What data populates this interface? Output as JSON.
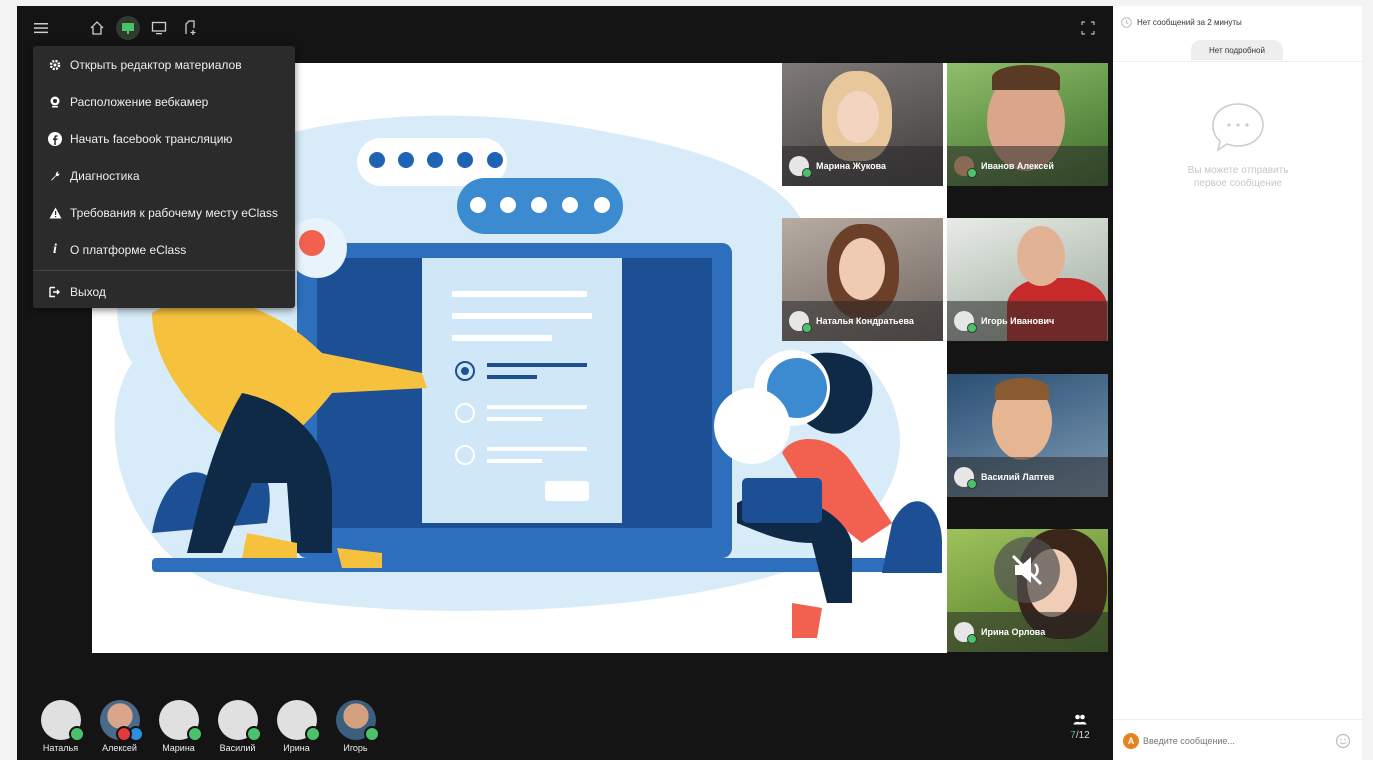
{
  "colors": {
    "accent": "#49c26b",
    "dark": "#141414",
    "menu": "#2b2b2b",
    "chat_avatar": "#e8821e"
  },
  "menu": {
    "items": [
      {
        "label": "Открыть редактор материалов",
        "icon": "gear-icon"
      },
      {
        "label": "Расположение вебкамер",
        "icon": "webcam-icon"
      },
      {
        "label": "Начать facebook трансляцию",
        "icon": "facebook-icon"
      },
      {
        "label": "Диагностика",
        "icon": "wrench-icon"
      },
      {
        "label": "Требования к рабочему месту eClass",
        "icon": "warning-icon"
      },
      {
        "label": "О платформе eClass",
        "icon": "info-icon"
      }
    ],
    "exit_label": "Выход"
  },
  "tiles": [
    {
      "name": "Марина Жукова"
    },
    {
      "name": "Иванов Алексей"
    },
    {
      "name": "Наталья Кондратьева"
    },
    {
      "name": "Игорь Иванович"
    },
    {
      "name": "Василий Лаптев"
    },
    {
      "name": "Ирина Орлова",
      "muted": true
    }
  ],
  "participants": [
    {
      "name": "Наталья"
    },
    {
      "name": "Алексей"
    },
    {
      "name": "Марина"
    },
    {
      "name": "Василий"
    },
    {
      "name": "Ирина"
    },
    {
      "name": "Игорь"
    }
  ],
  "counter": {
    "current": "7",
    "total": "12",
    "sep": "/"
  },
  "chat": {
    "status": "Нет сообщений за 2 минуты",
    "filter": "Нет подробной",
    "empty": "Вы можете отправить первое сообщение",
    "input_placeholder": "Введите сообщение...",
    "avatar_letter": "A"
  }
}
